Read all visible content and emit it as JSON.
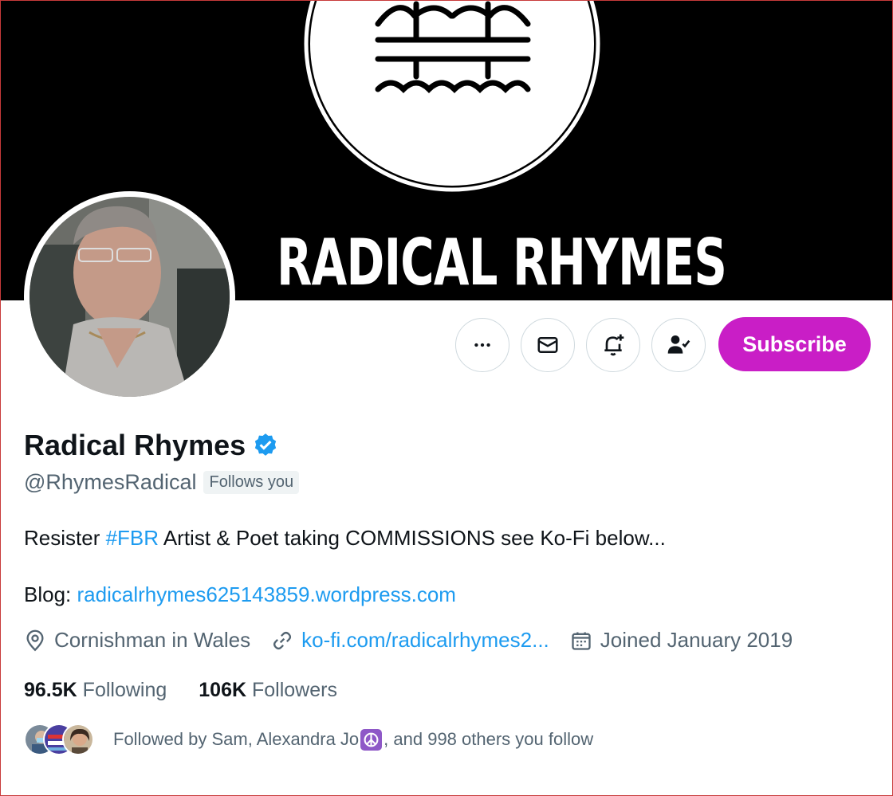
{
  "banner": {
    "title": "RADICAL RHYMES"
  },
  "profile": {
    "display_name": "Radical Rhymes",
    "handle": "@RhymesRadical",
    "follows_you": "Follows you",
    "verified": true
  },
  "actions": {
    "more": "more-icon",
    "message": "mail-icon",
    "notify": "bell-plus-icon",
    "following": "person-check-icon",
    "subscribe_label": "Subscribe"
  },
  "bio": {
    "pre": "Resister ",
    "hashtag": "#FBR",
    "post": " Artist & Poet taking COMMISSIONS see Ko-Fi below...",
    "blog_label": "Blog: ",
    "blog_link": "radicalrhymes625143859.wordpress.com"
  },
  "meta": {
    "location": "Cornishman in Wales",
    "website": "ko-fi.com/radicalrhymes2...",
    "joined": "Joined January 2019"
  },
  "stats": {
    "following_count": "96.5K",
    "following_label": "Following",
    "followers_count": "106K",
    "followers_label": "Followers"
  },
  "followed_by": {
    "pre": "Followed by Sam, Alexandra Jo ",
    "post": ", and 998 others you follow"
  },
  "colors": {
    "accent": "#1d9bf0",
    "subscribe": "#c91ec6",
    "muted": "#536471",
    "text": "#0f1419",
    "verified": "#1d9bf0"
  }
}
